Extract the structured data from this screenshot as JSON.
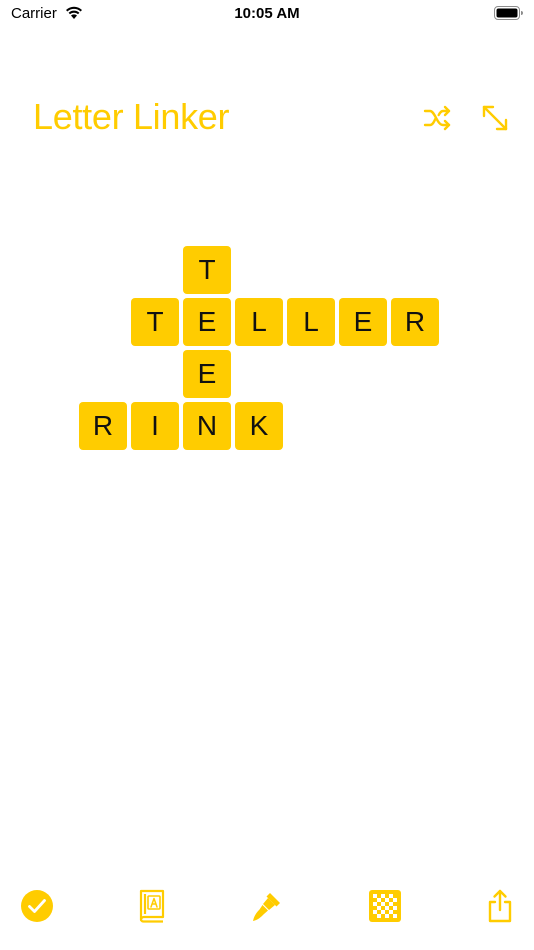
{
  "status_bar": {
    "carrier": "Carrier",
    "time": "10:05 AM"
  },
  "header": {
    "title": "Letter Linker",
    "shuffle_icon": "shuffle-icon",
    "expand_icon": "expand-icon"
  },
  "accent_color": "#ffcc00",
  "tile_text_color": "#111111",
  "board": {
    "words": [
      {
        "word": "TELLER",
        "direction": "across"
      },
      {
        "word": "TEEN",
        "direction": "down"
      },
      {
        "word": "RINK",
        "direction": "across"
      }
    ],
    "tiles": [
      {
        "letter": "T",
        "col": 2,
        "row": 0
      },
      {
        "letter": "T",
        "col": 1,
        "row": 1
      },
      {
        "letter": "E",
        "col": 2,
        "row": 1
      },
      {
        "letter": "L",
        "col": 3,
        "row": 1
      },
      {
        "letter": "L",
        "col": 4,
        "row": 1
      },
      {
        "letter": "E",
        "col": 5,
        "row": 1
      },
      {
        "letter": "R",
        "col": 6,
        "row": 1
      },
      {
        "letter": "E",
        "col": 2,
        "row": 2
      },
      {
        "letter": "R",
        "col": 0,
        "row": 3
      },
      {
        "letter": "I",
        "col": 1,
        "row": 3
      },
      {
        "letter": "N",
        "col": 2,
        "row": 3
      },
      {
        "letter": "K",
        "col": 3,
        "row": 3
      }
    ]
  },
  "tabbar": {
    "items": [
      {
        "icon": "check-circle-icon"
      },
      {
        "icon": "dictionary-icon"
      },
      {
        "icon": "paintbrush-icon"
      },
      {
        "icon": "checkerboard-icon"
      },
      {
        "icon": "share-icon"
      }
    ]
  }
}
